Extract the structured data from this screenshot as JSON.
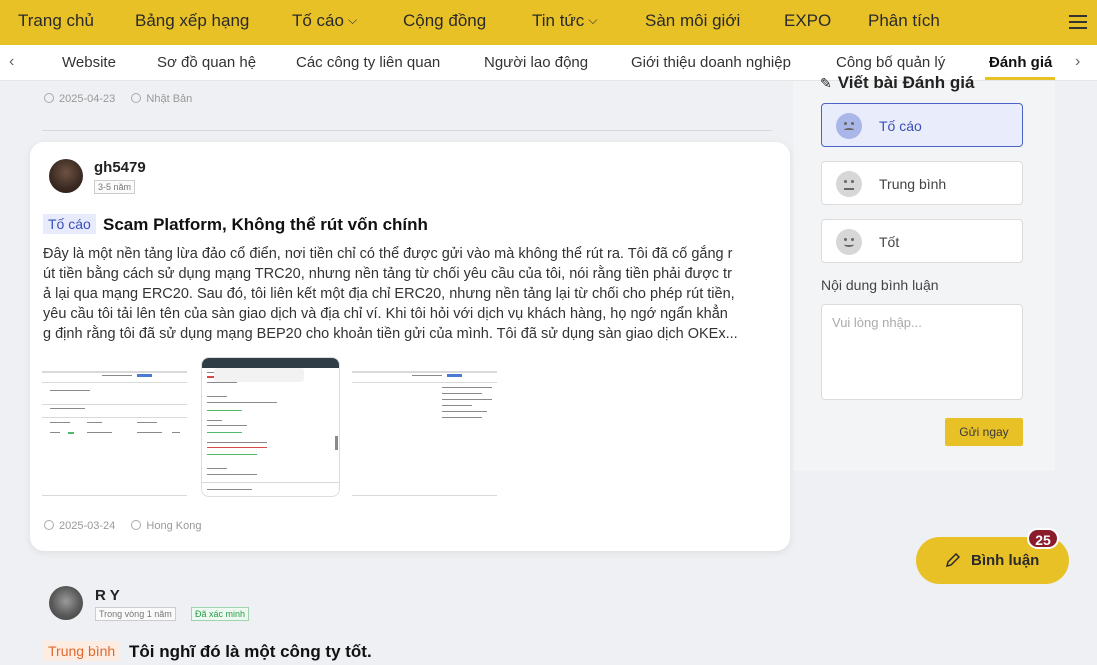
{
  "topnav": {
    "items": [
      "Trang chủ",
      "Bảng xếp hạng",
      "Tố cáo",
      "Cộng đồng",
      "Tin tức",
      "Sàn môi giới",
      "EXPO",
      "Phân tích"
    ]
  },
  "subtabs": {
    "items": [
      "Website",
      "Sơ đồ quan hệ",
      "Các công ty liên quan",
      "Người lao động",
      "Giới thiệu doanh nghiệp",
      "Công bố quản lý",
      "Đánh giá"
    ]
  },
  "prev_review": {
    "date": "2025-04-23",
    "location": "Nhật Bản"
  },
  "review": {
    "username": "gh5479",
    "tenure": "3-5 năm",
    "tag": "Tố cáo",
    "title": "Scam Platform, Không thể rút vốn chính",
    "lines": [
      "Đây là một nền tảng lừa đảo cổ điển, nơi tiền chỉ có thể được gửi vào mà không thể rút ra. Tôi đã cố gắng r",
      "út tiền bằng cách sử dụng mạng TRC20, nhưng nền tảng từ chối yêu cầu của tôi, nói rằng tiền phải được tr",
      "ả lại qua mạng ERC20. Sau đó, tôi liên kết một địa chỉ ERC20, nhưng nền tảng lại từ chối cho phép rút tiền,",
      "yêu cầu tôi tải lên tên của sàn giao dịch và địa chỉ ví. Khi tôi hỏi với dịch vụ khách hàng, họ ngớ ngẩn khẳn",
      "g định rằng tôi đã sử dụng mạng BEP20 cho khoản tiền gửi của mình. Tôi đã sử dụng sàn giao dịch OKEx..."
    ],
    "date": "2025-03-24",
    "location": "Hong Kong"
  },
  "next_review": {
    "username": "R Y",
    "tenure": "Trong vòng 1 năm",
    "verified": "Đã xác minh",
    "tag": "Trung bình",
    "title": "Tôi nghĩ đó là một công ty tốt."
  },
  "panel": {
    "title": "Viết bài Đánh giá",
    "options": [
      "Tố cáo",
      "Trung bình",
      "Tốt"
    ],
    "comment_label": "Nội dung bình luận",
    "placeholder": "Vui lòng nhập...",
    "send": "Gửi ngay"
  },
  "fab": {
    "label": "Bình luận",
    "count": "25"
  },
  "colors": {
    "brand": "#e8c127",
    "complaint": "#3a4fb8",
    "neutral": "#e0682c",
    "badge": "#8b1c2c"
  }
}
